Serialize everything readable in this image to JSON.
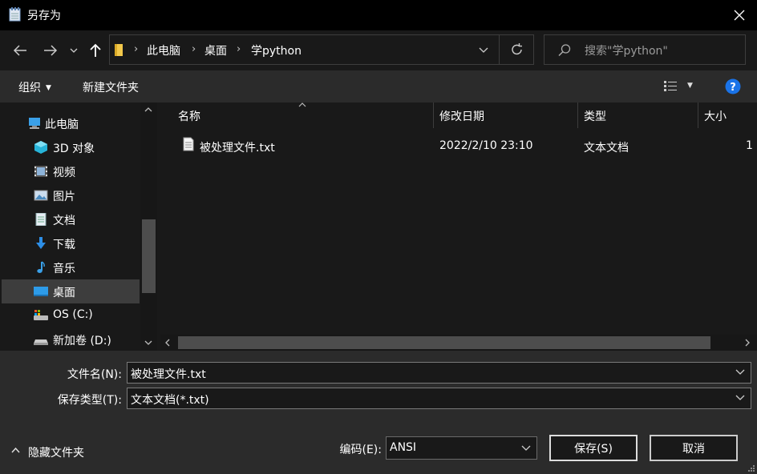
{
  "window": {
    "title": "另存为",
    "close_icon": "close-icon"
  },
  "nav": {
    "breadcrumbs": [
      "此电脑",
      "桌面",
      "学python"
    ],
    "search_placeholder": "搜索\"学python\""
  },
  "toolbar": {
    "organize_label": "组织",
    "new_folder_label": "新建文件夹"
  },
  "sidebar": {
    "items": [
      {
        "label": "此电脑",
        "icon": "computer-icon"
      },
      {
        "label": "3D 对象",
        "icon": "3d-objects-icon"
      },
      {
        "label": "视频",
        "icon": "video-icon"
      },
      {
        "label": "图片",
        "icon": "pictures-icon"
      },
      {
        "label": "文档",
        "icon": "documents-icon"
      },
      {
        "label": "下载",
        "icon": "download-icon"
      },
      {
        "label": "音乐",
        "icon": "music-icon"
      },
      {
        "label": "桌面",
        "icon": "desktop-icon",
        "selected": true
      },
      {
        "label": "OS (C:)",
        "icon": "drive-c-icon"
      },
      {
        "label": "新加卷 (D:)",
        "icon": "drive-d-icon"
      }
    ]
  },
  "file_list": {
    "columns": [
      "名称",
      "修改日期",
      "类型",
      "大小"
    ],
    "rows": [
      {
        "name": "被处理文件.txt",
        "modified": "2022/2/10 23:10",
        "type": "文本文档",
        "size": "1"
      }
    ]
  },
  "form": {
    "filename_label": "文件名(N):",
    "filename_value": "被处理文件.txt",
    "filetype_label": "保存类型(T):",
    "filetype_value": "文本文档(*.txt)",
    "encoding_label": "编码(E):",
    "encoding_value": "ANSI",
    "hide_folders_label": "隐藏文件夹",
    "save_label": "保存(S)",
    "cancel_label": "取消"
  },
  "colors": {
    "background": "#191919",
    "toolbar": "#2b2b2b",
    "titlebar": "#000000",
    "help": "#1a73e8"
  }
}
